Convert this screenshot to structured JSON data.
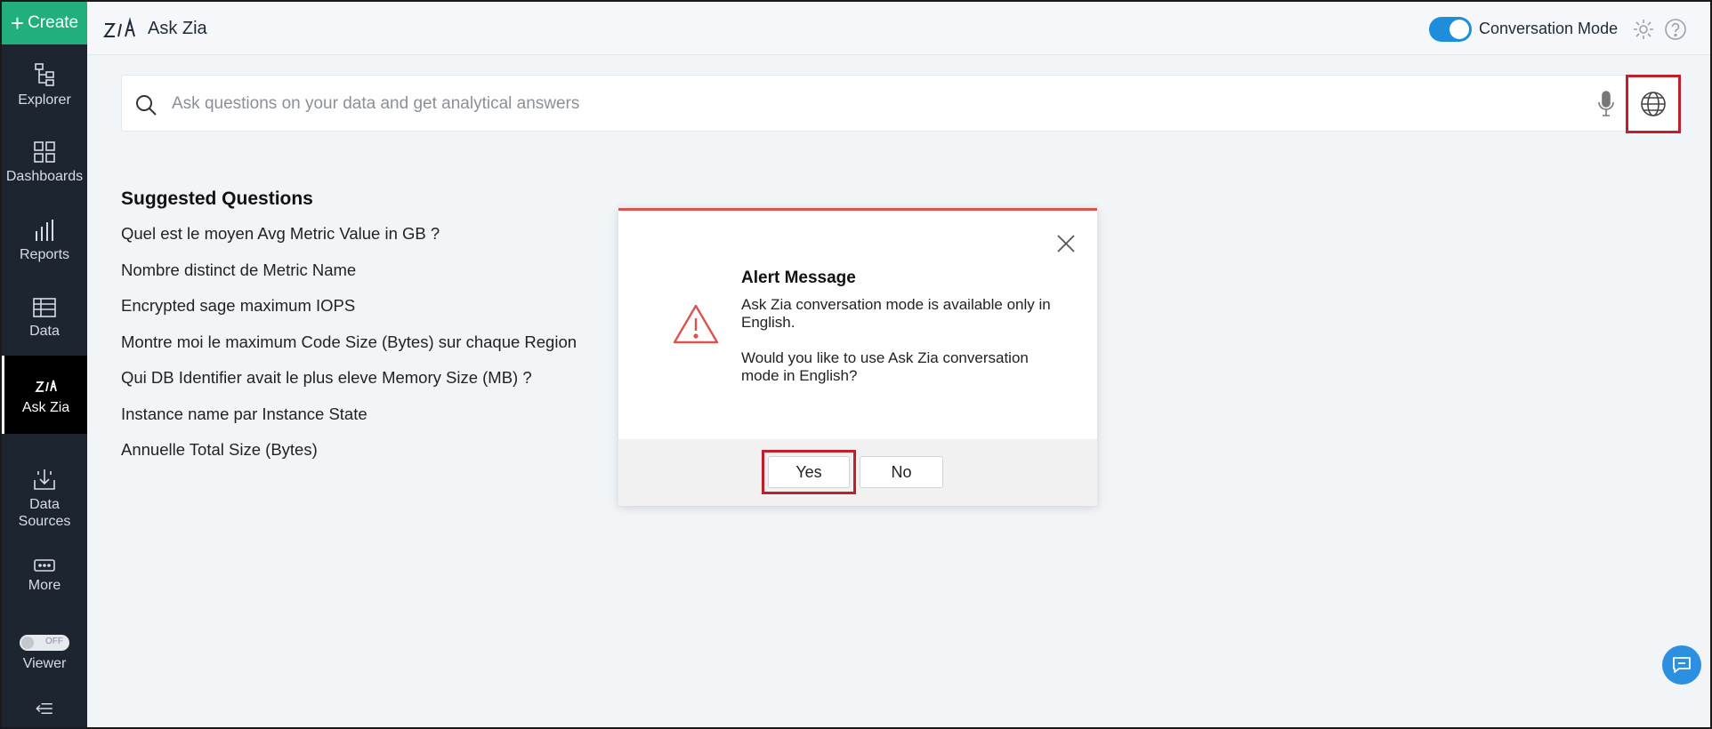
{
  "sidebar": {
    "create_label": "Create",
    "items": [
      {
        "label": "Explorer",
        "icon": "explorer-icon"
      },
      {
        "label": "Dashboards",
        "icon": "dashboards-icon"
      },
      {
        "label": "Reports",
        "icon": "reports-icon"
      },
      {
        "label": "Data",
        "icon": "data-icon"
      },
      {
        "label": "Ask Zia",
        "icon": "zia-icon",
        "active": true
      },
      {
        "label": "Data Sources",
        "icon": "data-sources-icon"
      },
      {
        "label": "More",
        "icon": "more-icon"
      },
      {
        "label": "Viewer",
        "icon": "viewer-toggle"
      }
    ],
    "viewer_toggle_text": "OFF",
    "collapse_icon": "collapse-menu-icon"
  },
  "header": {
    "title": "Ask Zia",
    "conversation_mode_label": "Conversation Mode",
    "conversation_mode_on": true
  },
  "search": {
    "placeholder": "Ask questions on your data and get analytical answers"
  },
  "suggested": {
    "title": "Suggested Questions",
    "questions": [
      "Quel est le moyen Avg Metric Value in GB ?",
      "Nombre distinct de Metric Name",
      "Encrypted sage maximum IOPS",
      "Montre moi le maximum Code Size (Bytes) sur chaque Region",
      "Qui DB Identifier avait le plus eleve Memory Size (MB) ?",
      "Instance name par Instance State",
      "Annuelle Total Size (Bytes)"
    ]
  },
  "modal": {
    "title": "Alert Message",
    "line1": "Ask Zia conversation mode is available only in English.",
    "line2": "Would you like to use Ask Zia conversation mode in English?",
    "yes_label": "Yes",
    "no_label": "No"
  },
  "colors": {
    "sidebar_bg": "#1d2531",
    "create_green": "#21b07c",
    "toggle_blue": "#1e8ddb",
    "highlight_red": "#c0202a",
    "alert_red": "#d9534f"
  }
}
